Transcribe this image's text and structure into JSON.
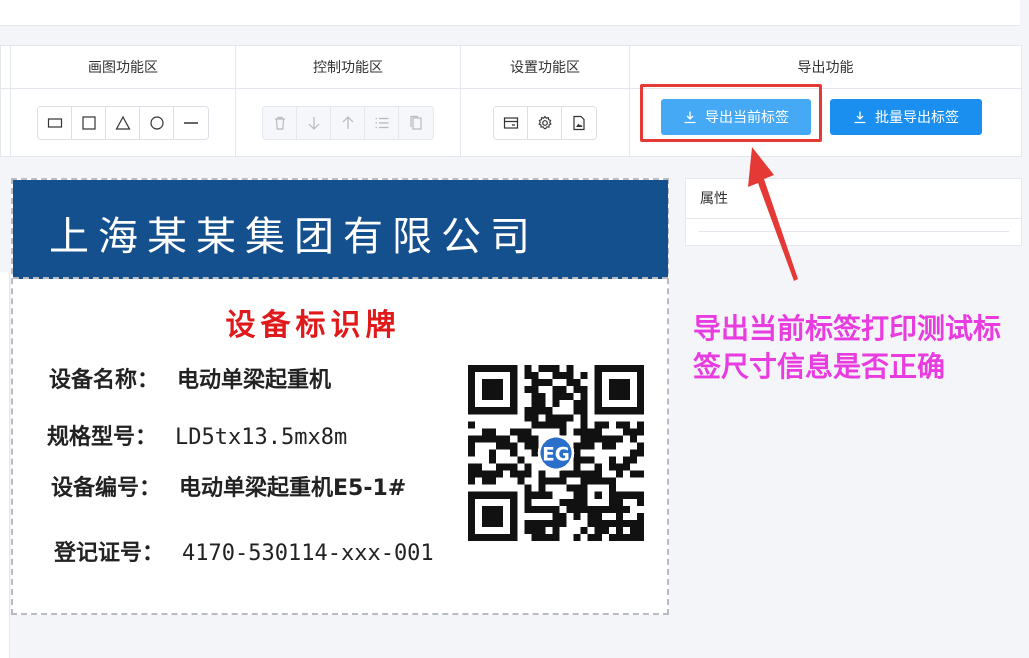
{
  "toolbar": {
    "sections": [
      {
        "title": "画图功能区"
      },
      {
        "title": "控制功能区"
      },
      {
        "title": "设置功能区"
      },
      {
        "title": "导出功能"
      }
    ],
    "export_current_label": "导出当前标签",
    "export_batch_label": "批量导出标签",
    "draw_tools": [
      "rectangle-icon",
      "square-icon",
      "triangle-icon",
      "circle-icon",
      "line-icon"
    ],
    "control_tools": [
      "trash-icon",
      "arrow-down-icon",
      "arrow-up-icon",
      "list-icon",
      "copy-icon"
    ],
    "setting_tools": [
      "card-icon",
      "gear-icon",
      "image-file-icon"
    ]
  },
  "label": {
    "company": "上海某某集团有限公司",
    "title": "设备标识牌",
    "fields": [
      {
        "key": "设备名称：",
        "value": "电动单梁起重机"
      },
      {
        "key": "规格型号：",
        "value": "LD5tx13.5mx8m"
      },
      {
        "key": "设备编号：",
        "value": "电动单梁起重机E5-1#"
      },
      {
        "key": "登记证号：",
        "value": "4170-530114-xxx-001"
      }
    ],
    "qr_logo_text": "EG",
    "colors": {
      "header": "#15508e",
      "title": "#e0191b"
    }
  },
  "properties": {
    "title": "属性"
  },
  "annotation": {
    "text": "导出当前标签打印测试标签尺寸信息是否正确",
    "color": "#e83ce0"
  }
}
